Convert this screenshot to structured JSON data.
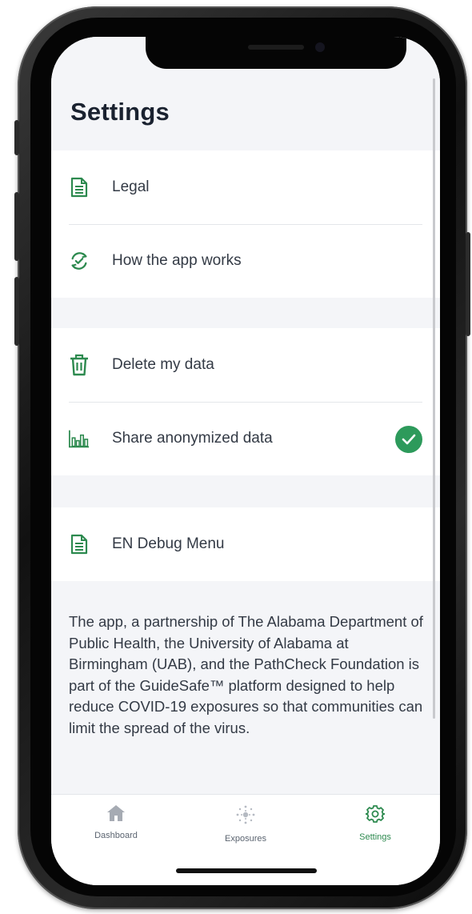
{
  "screen": {
    "title": "Settings"
  },
  "settings_groups": [
    {
      "items": [
        {
          "label": "Legal",
          "icon": "document-icon"
        },
        {
          "label": "How the app works",
          "icon": "refresh-check-icon"
        }
      ]
    },
    {
      "items": [
        {
          "label": "Delete my data",
          "icon": "trash-icon"
        },
        {
          "label": "Share anonymized data",
          "icon": "bar-chart-icon",
          "checked": true
        }
      ]
    },
    {
      "items": [
        {
          "label": "EN Debug Menu",
          "icon": "document-icon"
        }
      ]
    }
  ],
  "about": {
    "text": "The app, a partnership of The Alabama Department of Public Health, the University of Alabama at Birmingham (UAB), and the PathCheck Foundation is part of the GuideSafe™ platform designed to help reduce COVID-19 exposures so that communities can limit the spread of the virus."
  },
  "tab_bar": {
    "tabs": [
      {
        "label": "Dashboard",
        "icon": "home-icon",
        "active": false
      },
      {
        "label": "Exposures",
        "icon": "exposure-dots-icon",
        "active": false
      },
      {
        "label": "Settings",
        "icon": "gear-icon",
        "active": true
      }
    ]
  },
  "colors": {
    "accent": "#2d8a4f",
    "check": "#2d9a5b",
    "background": "#f4f5f8",
    "text": "#333a45",
    "title": "#1a2230"
  }
}
